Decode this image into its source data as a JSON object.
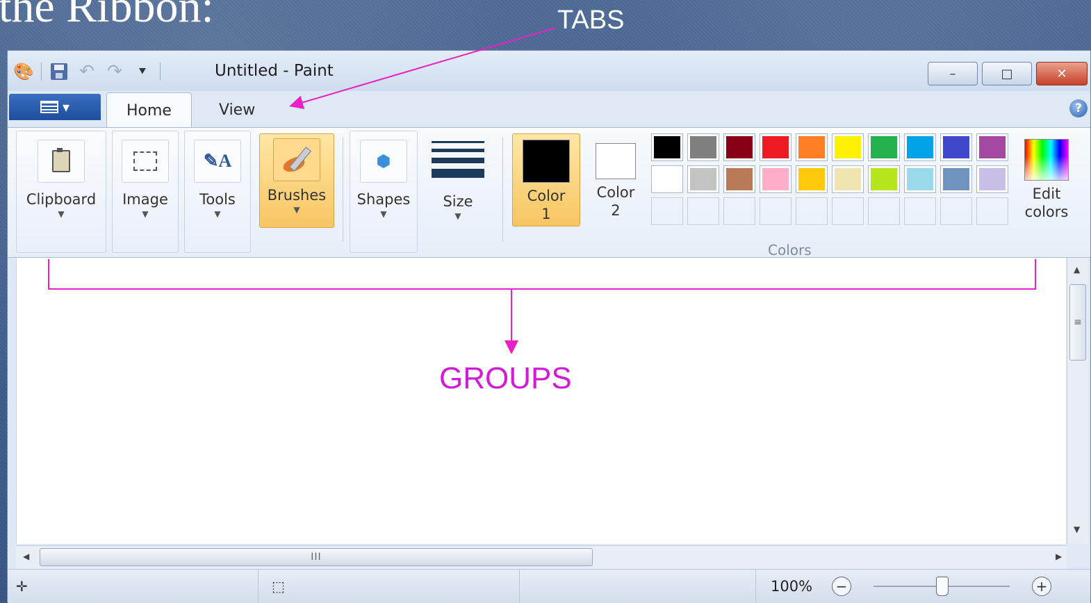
{
  "slide": {
    "heading": "the Ribbon:",
    "tabs_annotation": "TABS",
    "groups_annotation": "GROUPS"
  },
  "window": {
    "title": "Untitled - Paint",
    "minimize_symbol": "–",
    "maximize_symbol": "□",
    "close_symbol": "✕"
  },
  "tabs": [
    {
      "label": "Home",
      "active": true
    },
    {
      "label": "View",
      "active": false
    }
  ],
  "ribbon": {
    "groups": {
      "clipboard": "Clipboard",
      "image": "Image",
      "tools": "Tools",
      "brushes": "Brushes",
      "shapes": "Shapes",
      "size": "Size",
      "color1_line1": "Color",
      "color1_line2": "1",
      "color2_line1": "Color",
      "color2_line2": "2",
      "colors": "Colors",
      "edit_colors_line1": "Edit",
      "edit_colors_line2": "colors"
    },
    "color1": "#000000",
    "color2": "#ffffff",
    "palette_row1": [
      "#000000",
      "#7f7f7f",
      "#880015",
      "#ed1c24",
      "#ff7f27",
      "#fff200",
      "#22b14c",
      "#00a2e8",
      "#3f48cc",
      "#a349a4"
    ],
    "palette_row2": [
      "#ffffff",
      "#c3c3c3",
      "#b97a57",
      "#ffaec9",
      "#ffc90e",
      "#efe4b0",
      "#b5e61d",
      "#99d9ea",
      "#7092be",
      "#c8bfe7"
    ]
  },
  "statusbar": {
    "zoom": "100%",
    "zoom_out_symbol": "−",
    "zoom_in_symbol": "+",
    "zoom_level_fraction": 0.5
  },
  "icons": {
    "help": "?",
    "hscroll_grip": "III",
    "vscroll_grip": "≡"
  }
}
